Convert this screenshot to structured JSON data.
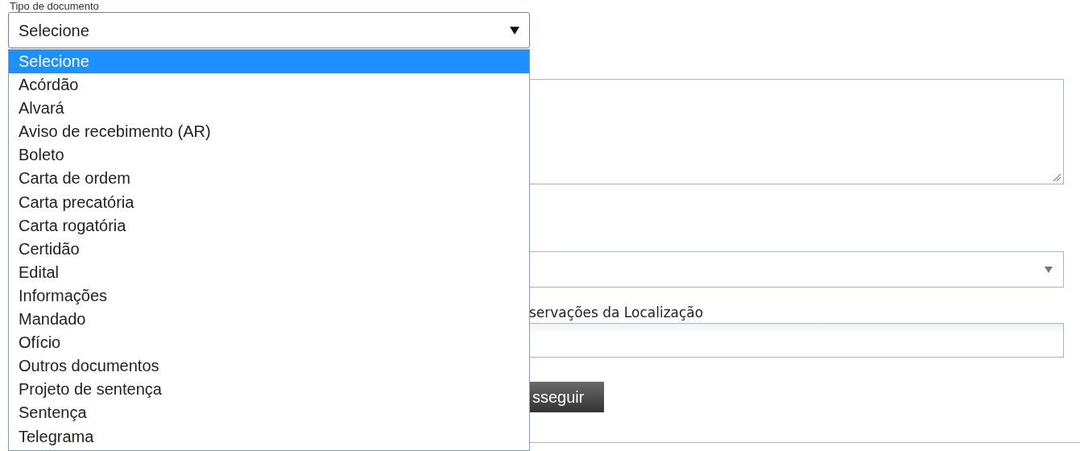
{
  "document_type": {
    "label": "Tipo de documento",
    "value": "Selecione",
    "expanded": true,
    "options": [
      {
        "label": "Selecione",
        "selected": true
      },
      {
        "label": "Acórdão",
        "selected": false
      },
      {
        "label": "Alvará",
        "selected": false
      },
      {
        "label": "Aviso de recebimento (AR)",
        "selected": false
      },
      {
        "label": "Boleto",
        "selected": false
      },
      {
        "label": "Carta de ordem",
        "selected": false
      },
      {
        "label": "Carta precatória",
        "selected": false
      },
      {
        "label": "Carta rogatória",
        "selected": false
      },
      {
        "label": "Certidão",
        "selected": false
      },
      {
        "label": "Edital",
        "selected": false
      },
      {
        "label": "Informações",
        "selected": false
      },
      {
        "label": "Mandado",
        "selected": false
      },
      {
        "label": "Ofício",
        "selected": false
      },
      {
        "label": "Outros documentos",
        "selected": false
      },
      {
        "label": "Projeto de sentença",
        "selected": false
      },
      {
        "label": "Sentença",
        "selected": false
      },
      {
        "label": "Telegrama",
        "selected": false
      }
    ]
  },
  "location_notes": {
    "label": "servações da Localização"
  },
  "submit_button": {
    "label": "sseguir"
  }
}
